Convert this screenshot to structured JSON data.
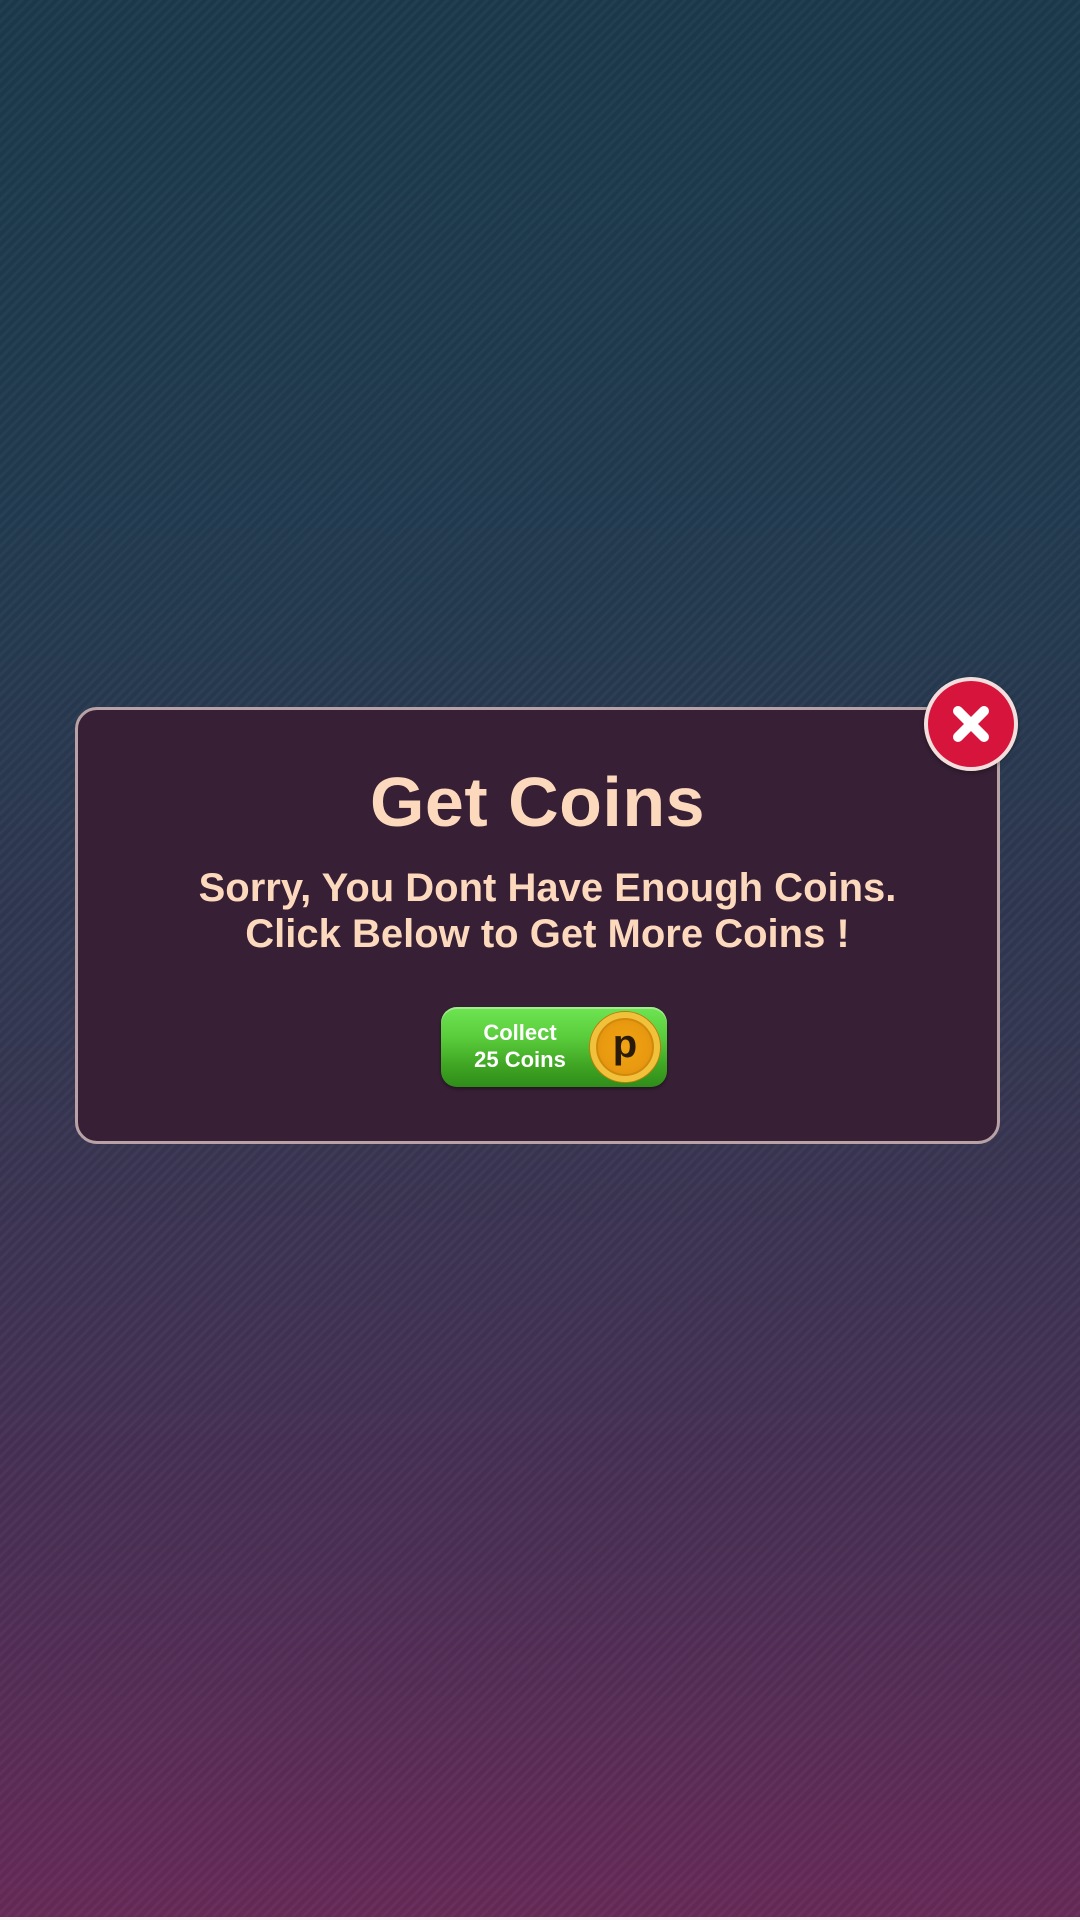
{
  "dialog": {
    "title": "Get Coins",
    "message_line1": "Sorry, You Dont Have Enough Coins.",
    "message_line2": "Click Below to Get More Coins !",
    "collect_button": {
      "line1": "Collect",
      "line2": "25 Coins",
      "coin_letter": "p",
      "coin_icon": "coin-icon"
    },
    "close_icon": "close-icon"
  },
  "colors": {
    "dialog_background": "#371f35",
    "text_accent": "#fcd9bd",
    "button_green": "#4fbf32",
    "close_red": "#d7153c",
    "coin_gold": "#f0a313"
  }
}
